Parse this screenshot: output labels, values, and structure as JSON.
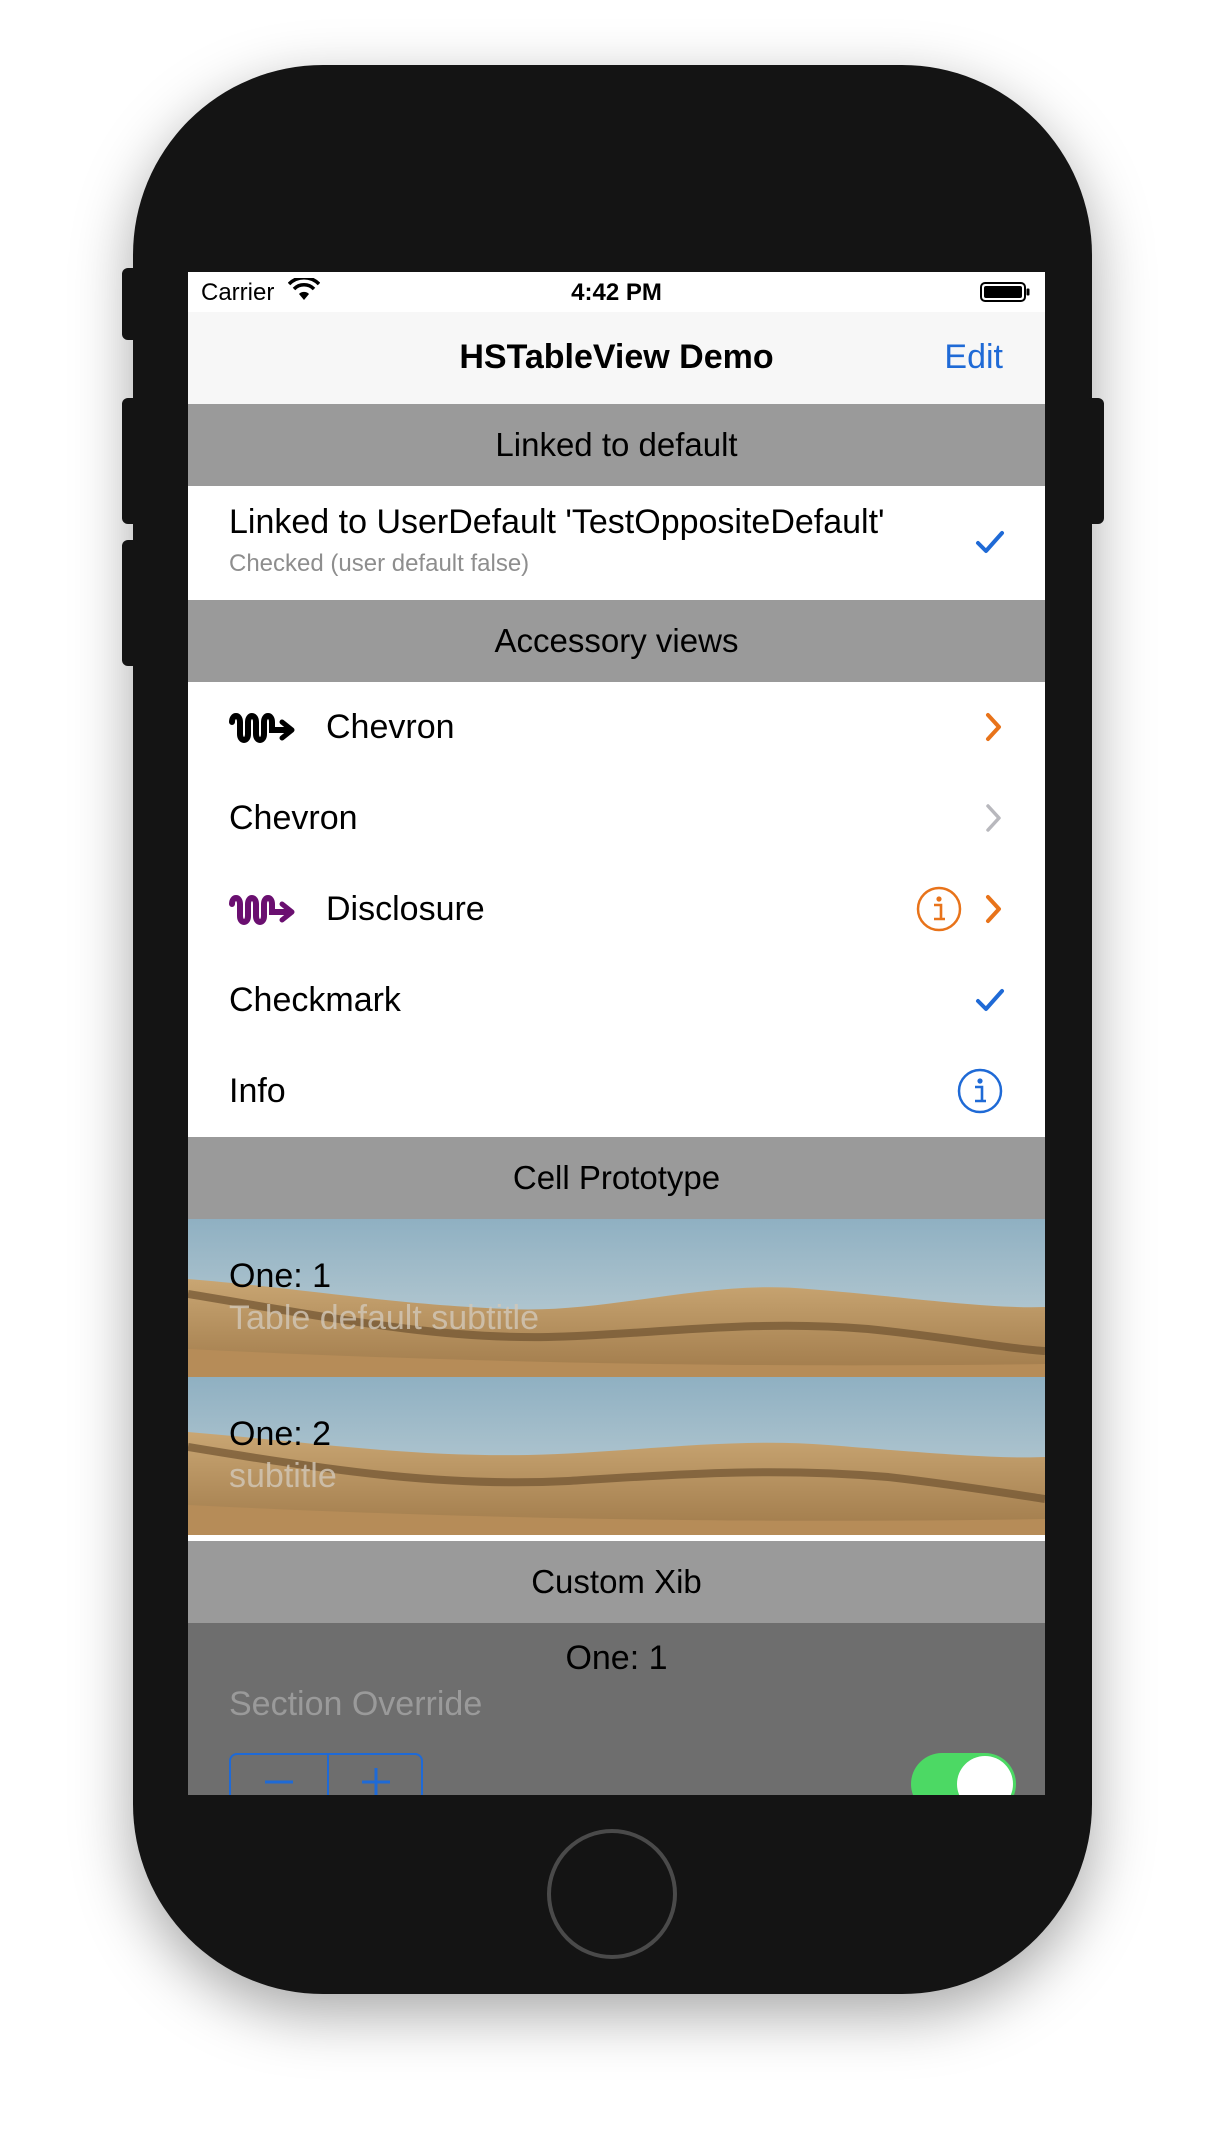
{
  "status_bar": {
    "carrier": "Carrier",
    "time": "4:42 PM"
  },
  "nav": {
    "title": "HSTableView Demo",
    "edit_label": "Edit"
  },
  "sections": {
    "linked": {
      "header": "Linked to default",
      "row": {
        "title": "Linked to UserDefault 'TestOppositeDefault'",
        "subtitle": "Checked (user default false)",
        "accessory": "checkmark-icon"
      }
    },
    "accessory": {
      "header": "Accessory views",
      "rows": [
        {
          "label": "Chevron",
          "icon": "wave-arrow-icon",
          "accessory": "chevron-right-icon"
        },
        {
          "label": "Chevron",
          "accessory": "chevron-right-icon"
        },
        {
          "label": "Disclosure",
          "icon": "wave-arrow-icon",
          "accessory": "info-icon"
        },
        {
          "label": "Checkmark",
          "accessory": "checkmark-icon"
        },
        {
          "label": "Info",
          "accessory": "info-icon"
        }
      ]
    },
    "prototype": {
      "header": "Cell Prototype",
      "rows": [
        {
          "title": "One: 1",
          "subtitle": "Table default subtitle"
        },
        {
          "title": "One: 2",
          "subtitle": "subtitle"
        }
      ]
    },
    "xib": {
      "header": "Custom Xib",
      "row": {
        "title": "One: 1",
        "subtitle": "Section Override",
        "toggle_on": true
      }
    }
  },
  "colors": {
    "accent_blue": "#1f6ad6",
    "orange": "#e8731a",
    "purple": "#6a0f70",
    "header_gray": "#9a9a9a",
    "toggle_green": "#4cd964"
  }
}
